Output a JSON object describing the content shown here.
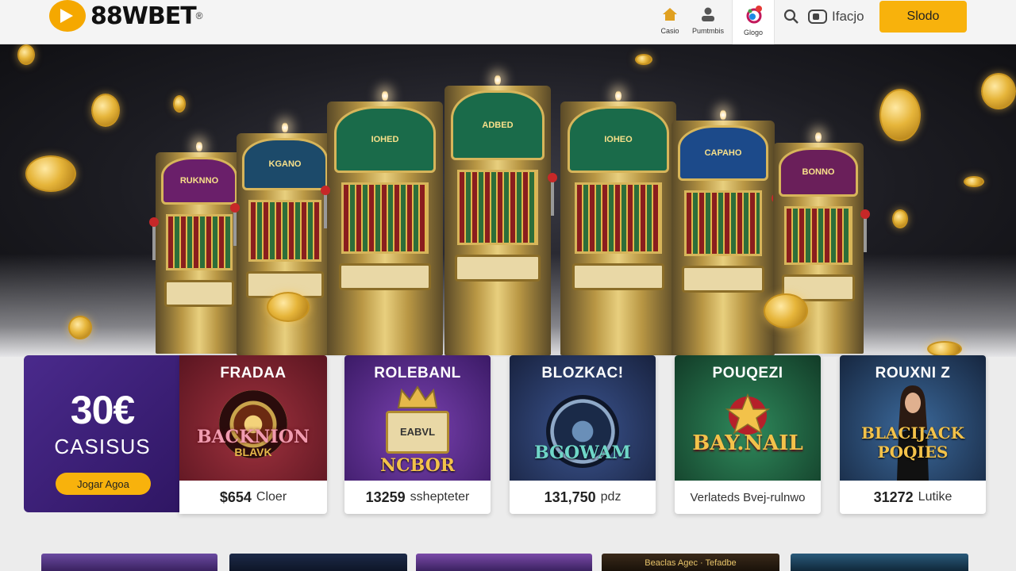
{
  "brand": {
    "name": "88WBET",
    "reg": "®"
  },
  "nav": [
    {
      "label": "Casio",
      "icon": "home-icon"
    },
    {
      "label": "Pumtmbis",
      "icon": "user-icon"
    },
    {
      "label": "Glogo",
      "icon": "app-logo-icon"
    }
  ],
  "header": {
    "link_label": "Ifacjo",
    "cta_label": "Slodo"
  },
  "promo": {
    "amount": "30€",
    "subtitle": "CASISUS",
    "button_label": "Jogar Agoa"
  },
  "cards": [
    {
      "title": "FRADAA",
      "logo": "BACKNION",
      "logo_sub": "BLAVK",
      "value": "$654",
      "caption": "Cloer",
      "bg": "#7a2330"
    },
    {
      "title": "ROLEBANL",
      "logo": "NCBOR",
      "logo_sub": "EABVL",
      "value": "13259",
      "caption": "sshepteter",
      "bg": "#5b2c8c"
    },
    {
      "title": "BLOZKAC!",
      "logo": "BGOWAM",
      "logo_sub": "",
      "value": "131,750",
      "caption": "pdz",
      "bg": "#273a66"
    },
    {
      "title": "POUQEZI",
      "logo": "BAY.NAIL",
      "logo_sub": "",
      "value": "",
      "caption": "Verlateds Bvej-rulnwo",
      "bg": "#1f6a46"
    },
    {
      "title": "ROUXNI Z",
      "logo": "BLACIJACK",
      "logo_sub": "POQIES",
      "value": "31272",
      "caption": "Lutike",
      "bg": "#2a4d7a"
    }
  ],
  "slot_machines": [
    {
      "marquee": "RUKNNO"
    },
    {
      "marquee": "KGANO"
    },
    {
      "marquee": "IOHED"
    },
    {
      "marquee": "ADBED"
    },
    {
      "marquee": "IOHEO"
    },
    {
      "marquee": "CAPAHO"
    },
    {
      "marquee": "BONNO"
    }
  ],
  "thumbnails": [
    {
      "label": ""
    },
    {
      "label": ""
    },
    {
      "label": ""
    },
    {
      "label": "Beaclas Agec · Tefadbe"
    },
    {
      "label": ""
    }
  ],
  "colors": {
    "accent": "#f8b20c",
    "promo_bg": "#3d2178",
    "gold": "#d7b55a"
  }
}
